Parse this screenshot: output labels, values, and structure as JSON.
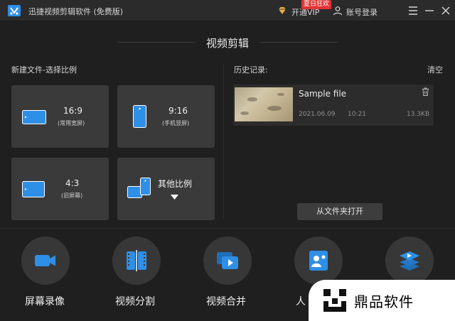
{
  "titlebar": {
    "title": "迅捷视频剪辑软件 (免费版)",
    "vip_label": "开通VIP",
    "vip_badge": "夏日狂欢",
    "login_label": "账号登录",
    "icons": [
      "app-logo",
      "vip-diamond-icon",
      "user-icon",
      "menu-icon",
      "minimize-icon",
      "close-icon"
    ]
  },
  "main": {
    "section_title": "视频剪辑",
    "new_file": {
      "label": "新建文件-选择比例",
      "ratios": [
        {
          "main": "16:9",
          "sub": "(常用宽屏)"
        },
        {
          "main": "9:16",
          "sub": "(手机竖屏)"
        },
        {
          "main": "4:3",
          "sub": "(旧屏幕)"
        },
        {
          "main": "其他比例",
          "sub": ""
        }
      ]
    },
    "history": {
      "label": "历史记录:",
      "clear_label": "清空",
      "items": [
        {
          "name": "Sample file",
          "date": "2021.06.09",
          "time": "10:21",
          "size": "13.3KB"
        }
      ],
      "open_folder_label": "从文件夹打开"
    }
  },
  "tools": [
    {
      "label": "屏幕录像",
      "icon": "camera-icon"
    },
    {
      "label": "视频分割",
      "icon": "film-split-icon"
    },
    {
      "label": "视频合并",
      "icon": "video-merge-icon"
    },
    {
      "label": "人",
      "icon": "person-card-icon"
    },
    {
      "label": "",
      "icon": "layers-play-icon"
    }
  ],
  "watermark": {
    "text": "鼎品软件"
  },
  "colors": {
    "accent_blue": "#2e8fe6",
    "background": "#1f1f1f",
    "card": "#3a3a3a",
    "vip_gold": "#e8b04a",
    "badge_red": "#e23434"
  }
}
